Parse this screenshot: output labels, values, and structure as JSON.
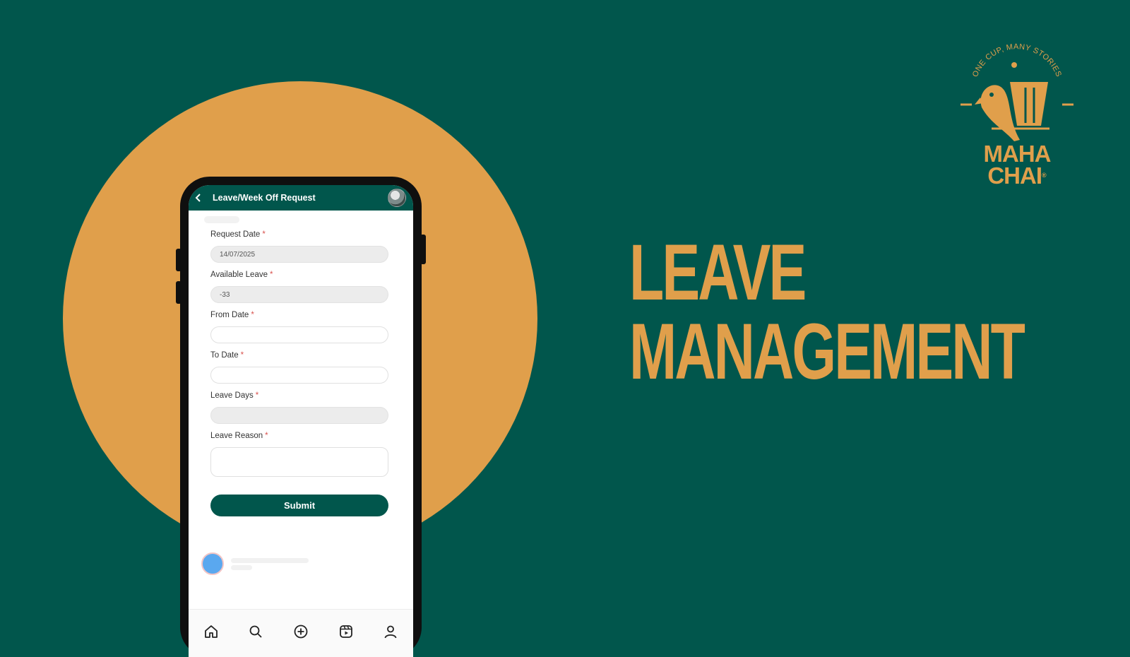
{
  "colors": {
    "background": "#01564c",
    "accent": "#e09f4b",
    "button": "#01564c",
    "required": "#d9534f"
  },
  "app": {
    "header_title": "Leave/Week Off Request",
    "form": {
      "request_date": {
        "label": "Request Date",
        "value": "14/07/2025"
      },
      "available_leave": {
        "label": "Available Leave",
        "value": "-33"
      },
      "from_date": {
        "label": "From Date",
        "value": ""
      },
      "to_date": {
        "label": "To Date",
        "value": ""
      },
      "leave_days": {
        "label": "Leave Days",
        "value": ""
      },
      "leave_reason": {
        "label": "Leave Reason",
        "value": ""
      },
      "required_mark": "*",
      "submit_label": "Submit"
    },
    "nav": [
      "home-icon",
      "search-icon",
      "add-icon",
      "reels-icon",
      "profile-icon"
    ]
  },
  "headline": {
    "line1": "LEAVE",
    "line2": "MANAGEMENT"
  },
  "logo": {
    "tagline": "ONE CUP, MANY STORIES",
    "line1": "MAHA",
    "line2": "CHAI",
    "reg": "®"
  }
}
